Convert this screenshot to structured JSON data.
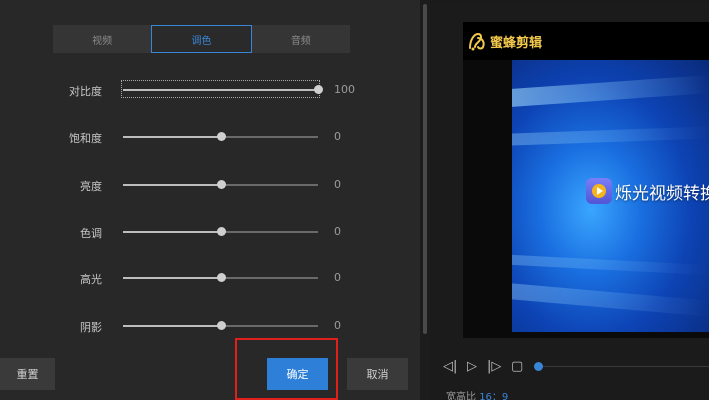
{
  "tabs": [
    {
      "label": "视频",
      "active": false
    },
    {
      "label": "调色",
      "active": true
    },
    {
      "label": "音频",
      "active": false
    }
  ],
  "adjustments": [
    {
      "label": "对比度",
      "value": "100",
      "level_pct": 100
    },
    {
      "label": "饱和度",
      "value": "0",
      "level_pct": 50
    },
    {
      "label": "亮度",
      "value": "0",
      "level_pct": 50
    },
    {
      "label": "色调",
      "value": "0",
      "level_pct": 50
    },
    {
      "label": "高光",
      "value": "0",
      "level_pct": 50
    },
    {
      "label": "阴影",
      "value": "0",
      "level_pct": 50
    }
  ],
  "buttons": {
    "reset": "重置",
    "ok": "确定",
    "cancel": "取消"
  },
  "preview": {
    "watermark_text": "蜜蜂剪辑",
    "overlay_text": "烁光视频转换"
  },
  "player": {
    "aspect_label": "宽高比",
    "aspect_value": "16：9"
  },
  "colors": {
    "accent": "#2d7fd8",
    "highlight": "#e0201c",
    "watermark": "#f2c94c"
  }
}
